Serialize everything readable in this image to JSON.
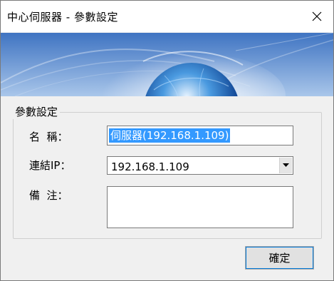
{
  "window": {
    "title": "中心伺服器 - 參數設定",
    "close_label": "×"
  },
  "group": {
    "legend": "參數設定"
  },
  "form": {
    "name_label": "名  稱：",
    "name_value": "伺服器(192.168.1.109)",
    "ip_label": "連結IP：",
    "ip_value": "192.168.1.109",
    "note_label": "備  注：",
    "note_value": ""
  },
  "buttons": {
    "ok_label": "確定"
  },
  "colors": {
    "selection": "#3399ff",
    "focus": "#0078d7"
  },
  "icons": [
    "close-icon",
    "chevron-down-icon"
  ]
}
